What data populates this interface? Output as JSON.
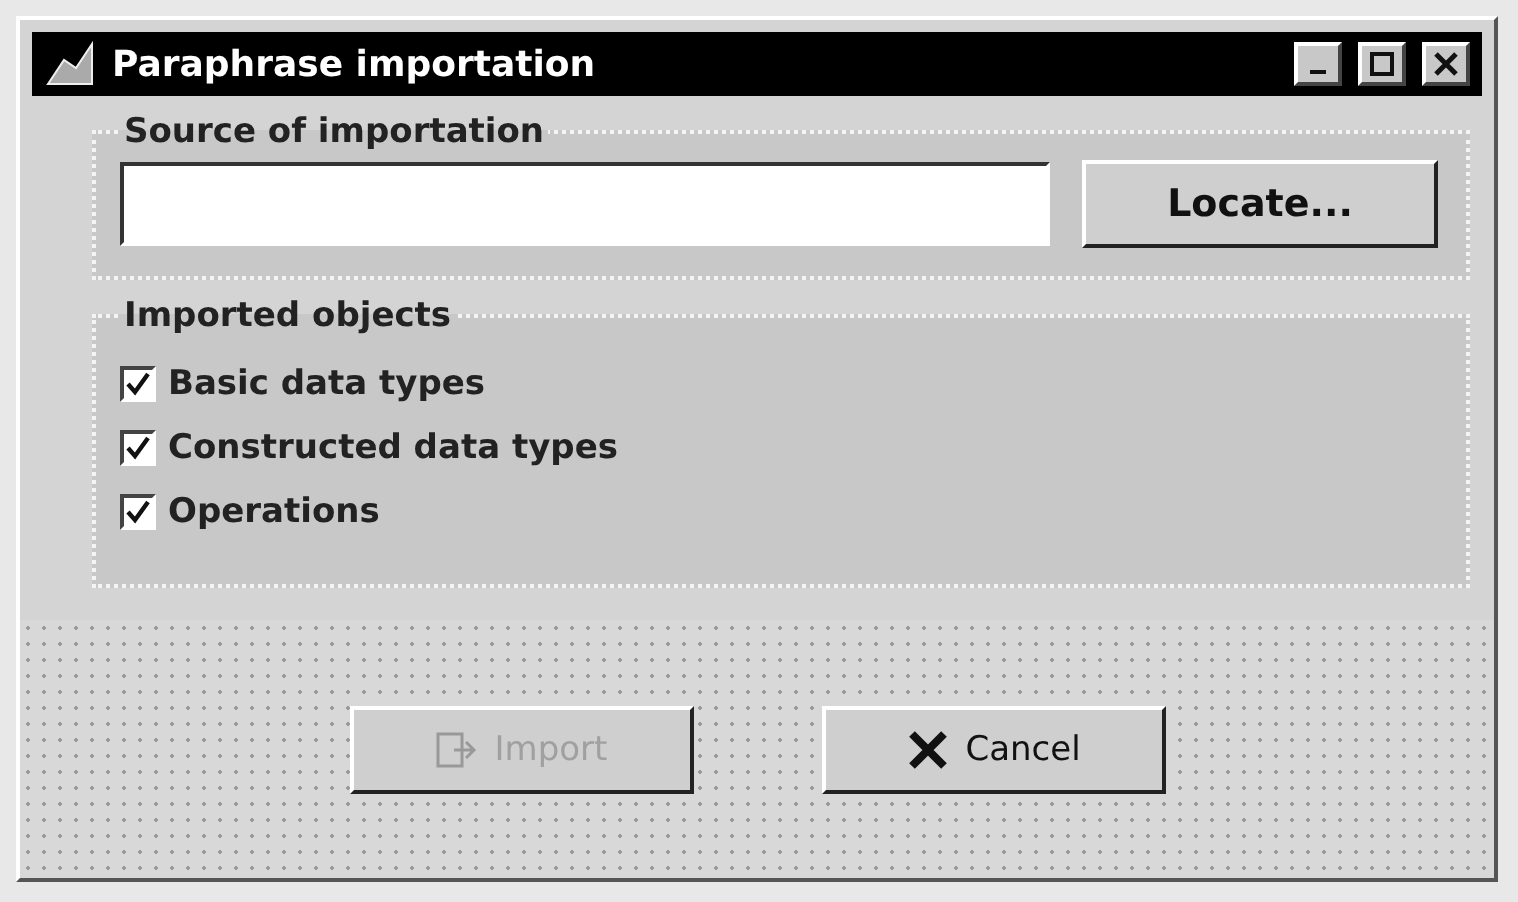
{
  "window": {
    "title": "Paraphrase importation"
  },
  "source": {
    "label": "Source of importation",
    "button": "Locate..."
  },
  "objects": {
    "label": "Imported objects",
    "options": [
      {
        "label": "Basic data types",
        "checked": true
      },
      {
        "label": "Constructed data types",
        "checked": true
      },
      {
        "label": "Operations",
        "checked": true
      }
    ]
  },
  "buttons": [
    {
      "kind": "import",
      "label": "Import",
      "disabled": true
    },
    {
      "kind": "cancel",
      "label": "Cancel",
      "disabled": false
    }
  ]
}
